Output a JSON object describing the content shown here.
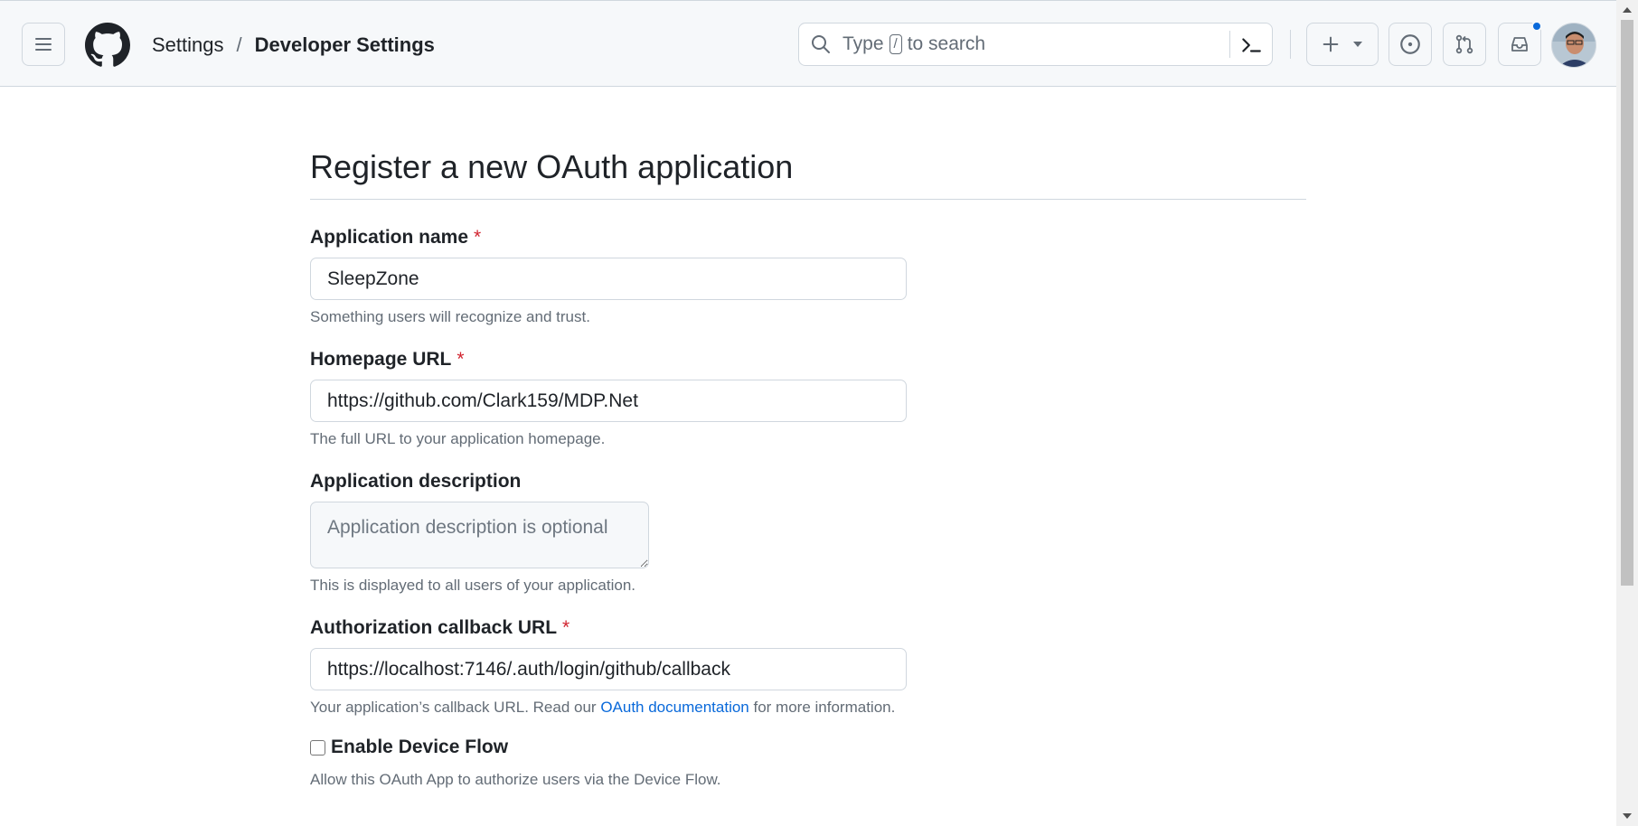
{
  "header": {
    "breadcrumb": {
      "settings": "Settings",
      "separator": "/",
      "current": "Developer Settings"
    },
    "search": {
      "prefix": "Type",
      "key": "/",
      "suffix": "to search"
    },
    "icons": {
      "menu": "hamburger-icon",
      "logo": "github-logo",
      "search": "search-icon",
      "command": "command-palette-icon",
      "create": "plus-icon",
      "issues": "issue-icon",
      "pulls": "pull-request-icon",
      "inbox": "inbox-icon"
    },
    "notification_color": "#0969da"
  },
  "page": {
    "title": "Register a new OAuth application"
  },
  "form": {
    "app_name": {
      "label": "Application name",
      "required_mark": "*",
      "value": "SleepZone",
      "note": "Something users will recognize and trust."
    },
    "homepage": {
      "label": "Homepage URL",
      "required_mark": "*",
      "value": "https://github.com/Clark159/MDP.Net",
      "note": "The full URL to your application homepage."
    },
    "description": {
      "label": "Application description",
      "placeholder": "Application description is optional",
      "note": "This is displayed to all users of your application."
    },
    "callback": {
      "label": "Authorization callback URL",
      "required_mark": "*",
      "value": "https://localhost:7146/.auth/login/github/callback",
      "note_prefix": "Your application’s callback URL. Read our",
      "note_link": "OAuth documentation",
      "note_suffix": "for more information."
    },
    "device_flow": {
      "label": "Enable Device Flow",
      "checked": false,
      "note": "Allow this OAuth App to authorize users via the Device Flow."
    }
  },
  "colors": {
    "required": "#d1242f",
    "link": "#0969da",
    "border": "#d0d7de",
    "muted": "#636c76"
  }
}
